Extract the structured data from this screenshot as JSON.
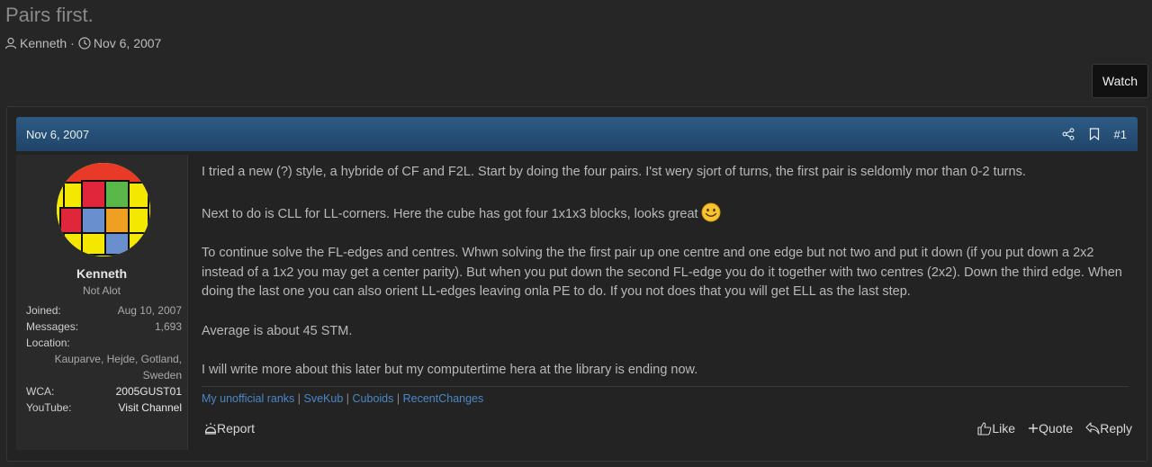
{
  "thread": {
    "title": "Pairs first.",
    "author": "Kenneth",
    "separator": "·",
    "date": "Nov 6, 2007",
    "watch_label": "Watch"
  },
  "post": {
    "date": "Nov 6, 2007",
    "number": "#1",
    "user": {
      "name": "Kenneth",
      "title": "Not Alot",
      "joined_label": "Joined:",
      "joined": "Aug 10, 2007",
      "messages_label": "Messages:",
      "messages": "1,693",
      "location_label": "Location:",
      "location": "Kauparve, Hejde, Gotland, Sweden",
      "wca_label": "WCA:",
      "wca": "2005GUST01",
      "youtube_label": "YouTube:",
      "youtube": "Visit Channel"
    },
    "paragraphs": [
      "I tried a new (?) style, a hybride of CF and F2L. Start by doing the four pairs. I'st wery sjort of turns, the first pair is seldomly mor than 0-2 turns.",
      "Next to do is CLL for LL-corners. Here the cube has got four 1x1x3 blocks, looks great",
      "To continue solve the FL-edges and centres. Whwn solving the the first pair up one centre and one edge but not two and put it down (if you put down a 2x2 instead of a 1x2 you may get a center parity). But when you put down the second FL-edge you do it together with two centres (2x2). Down the third edge. When doing the last one you can also orient LL-edges leaving onla PE to do. If you not does that you will get ELL as the last step.",
      "Average is about 45 STM.",
      "I will write more about this later but my computertime hera at the library is ending now."
    ],
    "signature": {
      "links": [
        "My unofficial ranks",
        "SveKub",
        "Cuboids",
        "RecentChanges"
      ],
      "separator": "|"
    },
    "actions": {
      "report": "Report",
      "like": "Like",
      "quote": "Quote",
      "reply": "Reply"
    }
  },
  "icons": [
    "user-icon",
    "clock-icon",
    "share-icon",
    "bookmark-icon",
    "smiley-icon",
    "report-icon",
    "like-icon",
    "quote-icon",
    "reply-icon"
  ],
  "colors": {
    "background": "#262626",
    "post_header": "#2a5480",
    "link": "#4b87c4"
  }
}
